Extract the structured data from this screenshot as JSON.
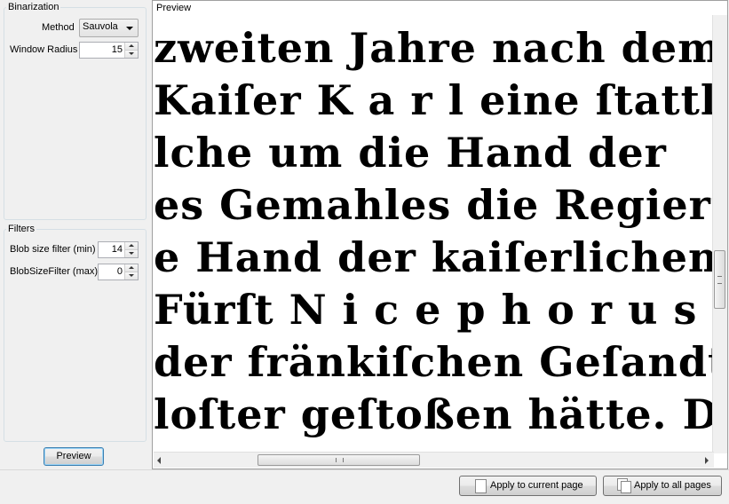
{
  "binarization": {
    "title": "Binarization",
    "method_label": "Method",
    "method_value": "Sauvola",
    "window_radius_label": "Window Radius",
    "window_radius_value": "15"
  },
  "filters": {
    "title": "Filters",
    "blob_min_label": "Blob size filter (min)",
    "blob_min_value": "14",
    "blob_max_label": "BlobSizeFilter (max)",
    "blob_max_value": "0"
  },
  "left_preview_button": "Preview",
  "preview_panel": {
    "title": "Preview",
    "lines": [
      "zweiten Jahre nach dem J",
      "Kaiſer K a r l eine ſtattlich",
      "lche  um  die  Hand  der",
      "es Gemahles die Regierun",
      "e Hand der kaiſerlichen V",
      " Fürſt  N i c e p h o r u s",
      " der fränkiſchen Geſandt",
      "loſter geſtoßen hätte. Die"
    ]
  },
  "bottom_bar": {
    "apply_current": "Apply to current page",
    "apply_all": "Apply to all pages"
  }
}
